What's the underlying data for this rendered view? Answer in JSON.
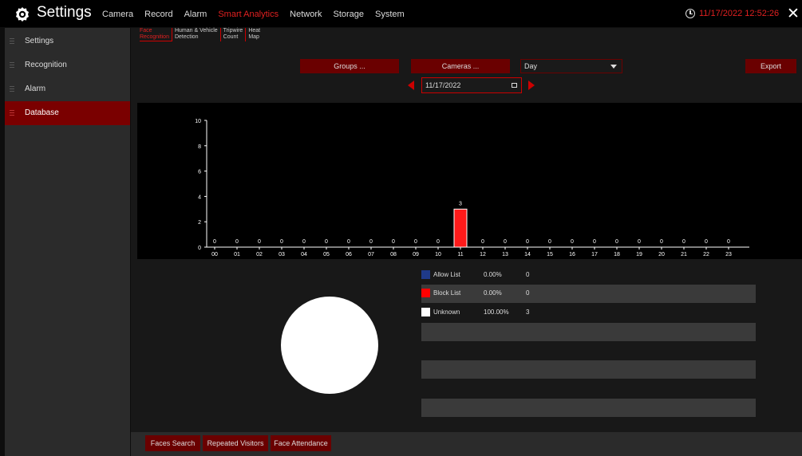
{
  "header": {
    "title": "Settings",
    "nav": [
      "Camera",
      "Record",
      "Alarm",
      "Smart Analytics",
      "Network",
      "Storage",
      "System"
    ],
    "active_nav": "Smart Analytics",
    "datetime": "11/17/2022 12:52:26",
    "close": "✕"
  },
  "sidebar": {
    "items": [
      {
        "label": "Settings"
      },
      {
        "label": "Recognition"
      },
      {
        "label": "Alarm"
      },
      {
        "label": "Database"
      }
    ],
    "active": "Database"
  },
  "subtabs": [
    {
      "line1": "Face",
      "line2": "Recognition"
    },
    {
      "line1": "Human & Vehicle",
      "line2": "Detection"
    },
    {
      "line1": "Tripwire",
      "line2": "Count"
    },
    {
      "line1": "Heat",
      "line2": "Map"
    }
  ],
  "toolbar": {
    "groups_label": "Groups ...",
    "cameras_label": "Cameras ...",
    "period_value": "Day",
    "export_label": "Export",
    "date_value": "11/17/2022"
  },
  "chart_data": {
    "type": "bar",
    "categories": [
      "00",
      "01",
      "02",
      "03",
      "04",
      "05",
      "06",
      "07",
      "08",
      "09",
      "10",
      "11",
      "12",
      "13",
      "14",
      "15",
      "16",
      "17",
      "18",
      "19",
      "20",
      "21",
      "22",
      "23"
    ],
    "values": [
      0,
      0,
      0,
      0,
      0,
      0,
      0,
      0,
      0,
      0,
      0,
      3,
      0,
      0,
      0,
      0,
      0,
      0,
      0,
      0,
      0,
      0,
      0,
      0
    ],
    "y_ticks": [
      0,
      2,
      4,
      6,
      8,
      10
    ],
    "ylim": [
      0,
      10
    ],
    "bar_color": "#ff1a1a"
  },
  "legend": [
    {
      "name": "Allow List",
      "percent": "0.00%",
      "count": "0",
      "color": "#1f3a8a"
    },
    {
      "name": "Block List",
      "percent": "0.00%",
      "count": "0",
      "color": "#ff0000"
    },
    {
      "name": "Unknown",
      "percent": "100.00%",
      "count": "3",
      "color": "#ffffff"
    }
  ],
  "pie_data": {
    "type": "pie",
    "values": [
      0,
      0,
      3
    ],
    "colors": [
      "#1f3a8a",
      "#ff0000",
      "#ffffff"
    ]
  },
  "footer": {
    "faces_search": "Faces Search",
    "repeated_visitors": "Repeated Visitors",
    "face_attendance": "Face Attendance"
  }
}
